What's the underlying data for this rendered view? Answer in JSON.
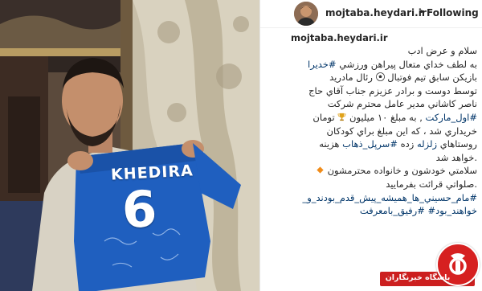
{
  "header": {
    "username": "mojtaba.heydari.ir",
    "separator": "•",
    "follow_status": "Following"
  },
  "photo": {
    "jersey_name": "KHEDIRA",
    "jersey_number": "6"
  },
  "caption": {
    "username": "mojtaba.heydari.ir",
    "lines": [
      "سلام و عرض ادب",
      "به لطف خداي متعال پيراهن ورزشي",
      "بازيكن سابق تيم فوتبال",
      "توسط دوست و برادر عزيزم جناب آقاي حاج",
      "ناصر كاشاني مدير عامل محترم شركت",
      ", به مبلغ ۱۰ ميليون",
      "خريداري شد ، كه اين مبلغ براي كودكان",
      "روستاهاي",
      "زده",
      "هزينه",
      ".خواهد شد",
      "سلامتي خودشون و خانواده محترمشون",
      ".صلواتي قرائت بفرماييد"
    ],
    "words": {
      "real_madrid": "رئال مادريد",
      "toman": "تومان",
      "zelzeleh": "زلزله"
    },
    "hashtags": {
      "khedira": "#خديرا",
      "aval_market": "#اول_ماركت",
      "sarpol": "#سرپل_ذهاب",
      "mam_hosseini": "#مام_حسيني_ها_هميشه_پيش_قدم_بودند_و",
      "mam_hosseini_tail": "_",
      "khahand_bood": "خواهند_بود#",
      "rafigh": "#رفيق_بامعرفت"
    }
  },
  "watermark": {
    "text": "باشگاه خبرنگاران"
  },
  "colors": {
    "hashtag": "#003569",
    "text": "#262626",
    "logo_red": "#cc1f1f"
  }
}
